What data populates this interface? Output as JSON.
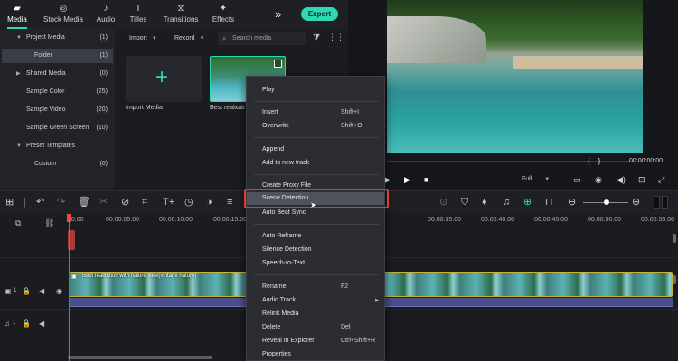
{
  "nav": {
    "tabs": [
      {
        "label": "Media",
        "icon": "folder-icon",
        "active": true
      },
      {
        "label": "Stock Media",
        "icon": "camera-icon",
        "active": false
      },
      {
        "label": "Audio",
        "icon": "music-note-icon",
        "active": false
      },
      {
        "label": "Titles",
        "icon": "text-t-icon",
        "active": false
      },
      {
        "label": "Transitions",
        "icon": "transition-icon",
        "active": false
      },
      {
        "label": "Effects",
        "icon": "sparkle-icon",
        "active": false
      }
    ],
    "more": "»",
    "export_label": "Export"
  },
  "sidebar": {
    "items": [
      {
        "label": "Project Media",
        "count": "(1)",
        "expanded": true
      },
      {
        "label": "Folder",
        "count": "(1)",
        "selected": true
      },
      {
        "label": "Shared Media",
        "count": "(0)"
      },
      {
        "label": "Sample Color",
        "count": "(25)"
      },
      {
        "label": "Sample Video",
        "count": "(20)"
      },
      {
        "label": "Sample Green Screen",
        "count": "(10)"
      },
      {
        "label": "Preset Templates",
        "count": "",
        "expanded": true
      },
      {
        "label": "Custom",
        "count": "(0)"
      }
    ]
  },
  "media_toolbar": {
    "import_label": "Import",
    "record_label": "Record",
    "search_placeholder": "Search media"
  },
  "media_items": [
    {
      "label": "Import Media"
    },
    {
      "label": "Best realxati"
    }
  ],
  "preview": {
    "timecode": "00:00:00:00",
    "brace_open": "{",
    "brace_close": "}",
    "quality": "Full"
  },
  "ruler": {
    "ticks": [
      "00:00",
      "00:00:05:00",
      "00:00:10:00",
      "00:00:15:00",
      "00:00:35:00",
      "00:00:40:00",
      "00:00:45:00",
      "00:00:50:00",
      "00:00:55:00"
    ]
  },
  "track": {
    "video_clip_label": "Best realxation with nature view(vintage nature)",
    "video_track_num": "1",
    "audio_track_num": "1"
  },
  "context_menu": {
    "groups": [
      [
        {
          "label": "Play",
          "shortcut": ""
        }
      ],
      [
        {
          "label": "Insert",
          "shortcut": "Shift+I"
        },
        {
          "label": "Overwrite",
          "shortcut": "Shift+O"
        }
      ],
      [
        {
          "label": "Append",
          "shortcut": ""
        },
        {
          "label": "Add to new track",
          "shortcut": ""
        }
      ],
      [
        {
          "label": "Create Proxy File",
          "shortcut": ""
        },
        {
          "label": "Scene Detection",
          "shortcut": "",
          "highlighted": true
        },
        {
          "label": "Auto Beat Sync",
          "shortcut": ""
        }
      ],
      [
        {
          "label": "Auto Reframe",
          "shortcut": ""
        },
        {
          "label": "Silence Detection",
          "shortcut": ""
        },
        {
          "label": "Speech-to-Text",
          "shortcut": ""
        }
      ],
      [
        {
          "label": "Rename",
          "shortcut": "F2"
        },
        {
          "label": "Audio Track",
          "shortcut": "",
          "submenu": true
        },
        {
          "label": "Relink Media",
          "shortcut": ""
        },
        {
          "label": "Delete",
          "shortcut": "Del"
        },
        {
          "label": "Reveal In Explorer",
          "shortcut": "Ctrl+Shift+R"
        },
        {
          "label": "Properties",
          "shortcut": ""
        }
      ]
    ]
  },
  "colors": {
    "accent": "#2fd8b4",
    "highlight_box": "#e53935",
    "playhead": "#e84a4a"
  }
}
